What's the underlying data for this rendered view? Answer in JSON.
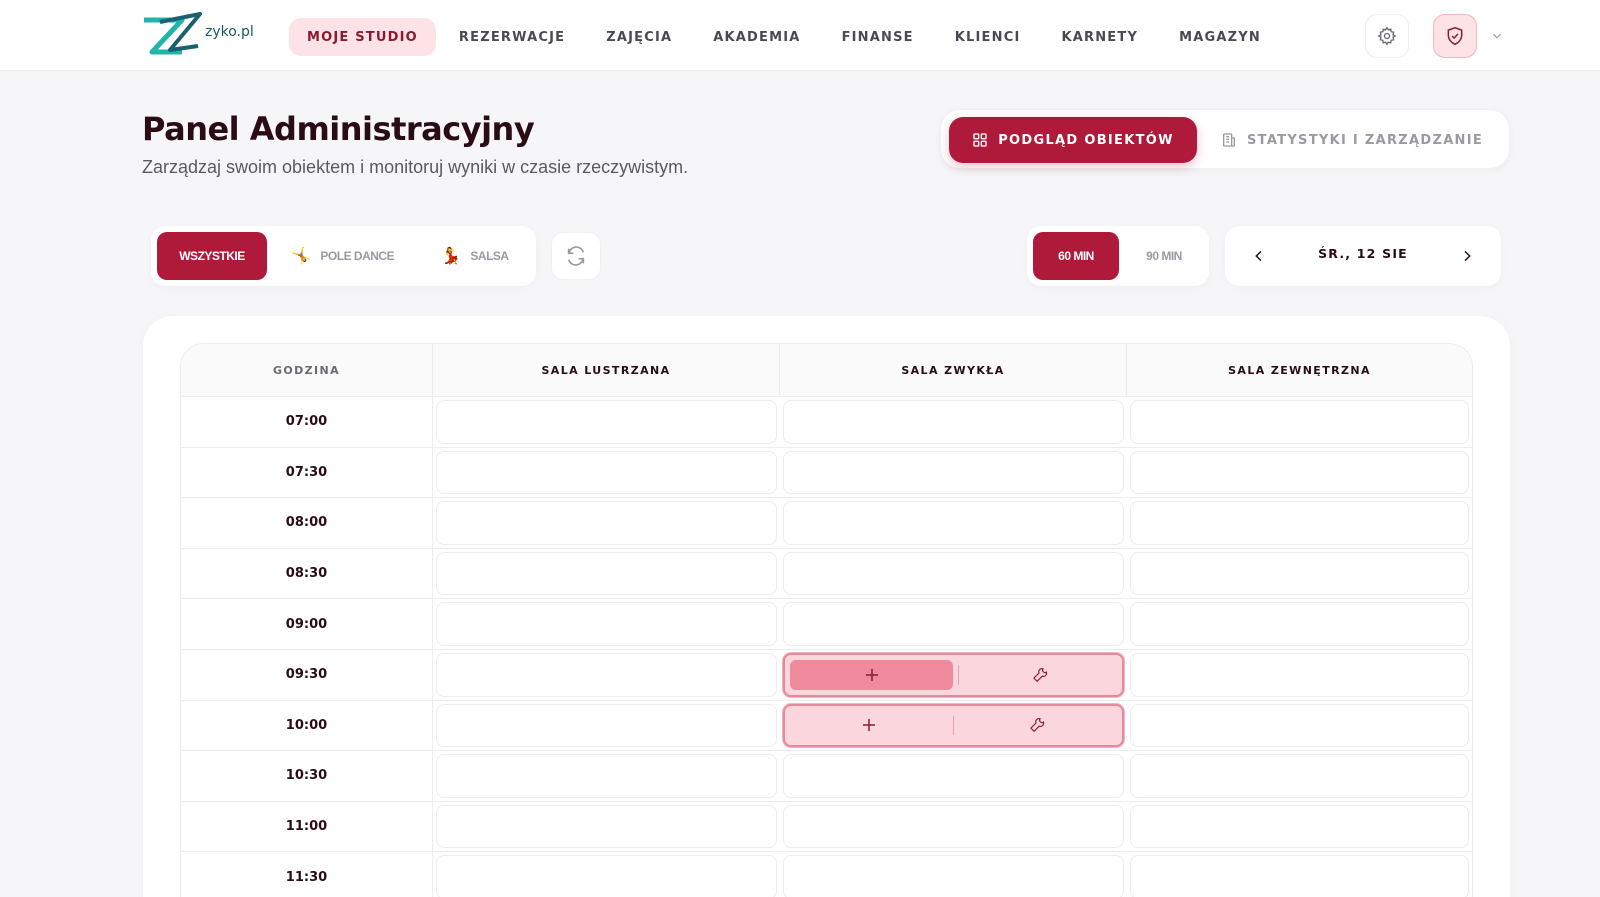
{
  "brand": {
    "name": "zyko.pl",
    "accent": "#b01a3a",
    "accent_soft": "#fde2e6"
  },
  "nav": {
    "items": [
      {
        "label": "MOJE STUDIO",
        "active": true
      },
      {
        "label": "REZERWACJE"
      },
      {
        "label": "ZAJĘCIA"
      },
      {
        "label": "AKADEMIA"
      },
      {
        "label": "FINANSE"
      },
      {
        "label": "KLIENCI"
      },
      {
        "label": "KARNETY"
      },
      {
        "label": "MAGAZYN"
      }
    ],
    "icons": [
      "gear-icon",
      "shield-icon",
      "chevron-down-icon"
    ]
  },
  "header": {
    "title": "Panel Administracyjny",
    "subtitle": "Zarządzaj swoim obiektem i monitoruj wyniki w czasie rzeczywistym."
  },
  "view_toggle": {
    "active_label": "PODGLĄD OBIEKTÓW",
    "inactive_label": "STATYSTYKI I ZARZĄDZANIE"
  },
  "filters": {
    "all": "WSZYSTKIE",
    "pole": {
      "label": "POLE DANCE",
      "emoji": "🤸"
    },
    "salsa": {
      "label": "SALSA",
      "emoji": "💃"
    }
  },
  "duration": {
    "active": "60 MIN",
    "inactive": "90 MIN"
  },
  "date": {
    "label": "ŚR., 12 SIE"
  },
  "schedule": {
    "time_header": "GODZINA",
    "rooms": [
      "SALA LUSTRZANA",
      "SALA ZWYKŁA",
      "SALA ZEWNĘTRZNA"
    ],
    "times": [
      "07:00",
      "07:30",
      "08:00",
      "08:30",
      "09:00",
      "09:30",
      "10:00",
      "10:30",
      "11:00",
      "11:30"
    ],
    "selected": [
      {
        "time": "09:30",
        "room": "SALA ZWYKŁA",
        "actions": [
          "plus-icon",
          "wrench-icon"
        ],
        "hovered": "plus-icon"
      },
      {
        "time": "10:00",
        "room": "SALA ZWYKŁA",
        "actions": [
          "plus-icon",
          "wrench-icon"
        ]
      }
    ]
  }
}
